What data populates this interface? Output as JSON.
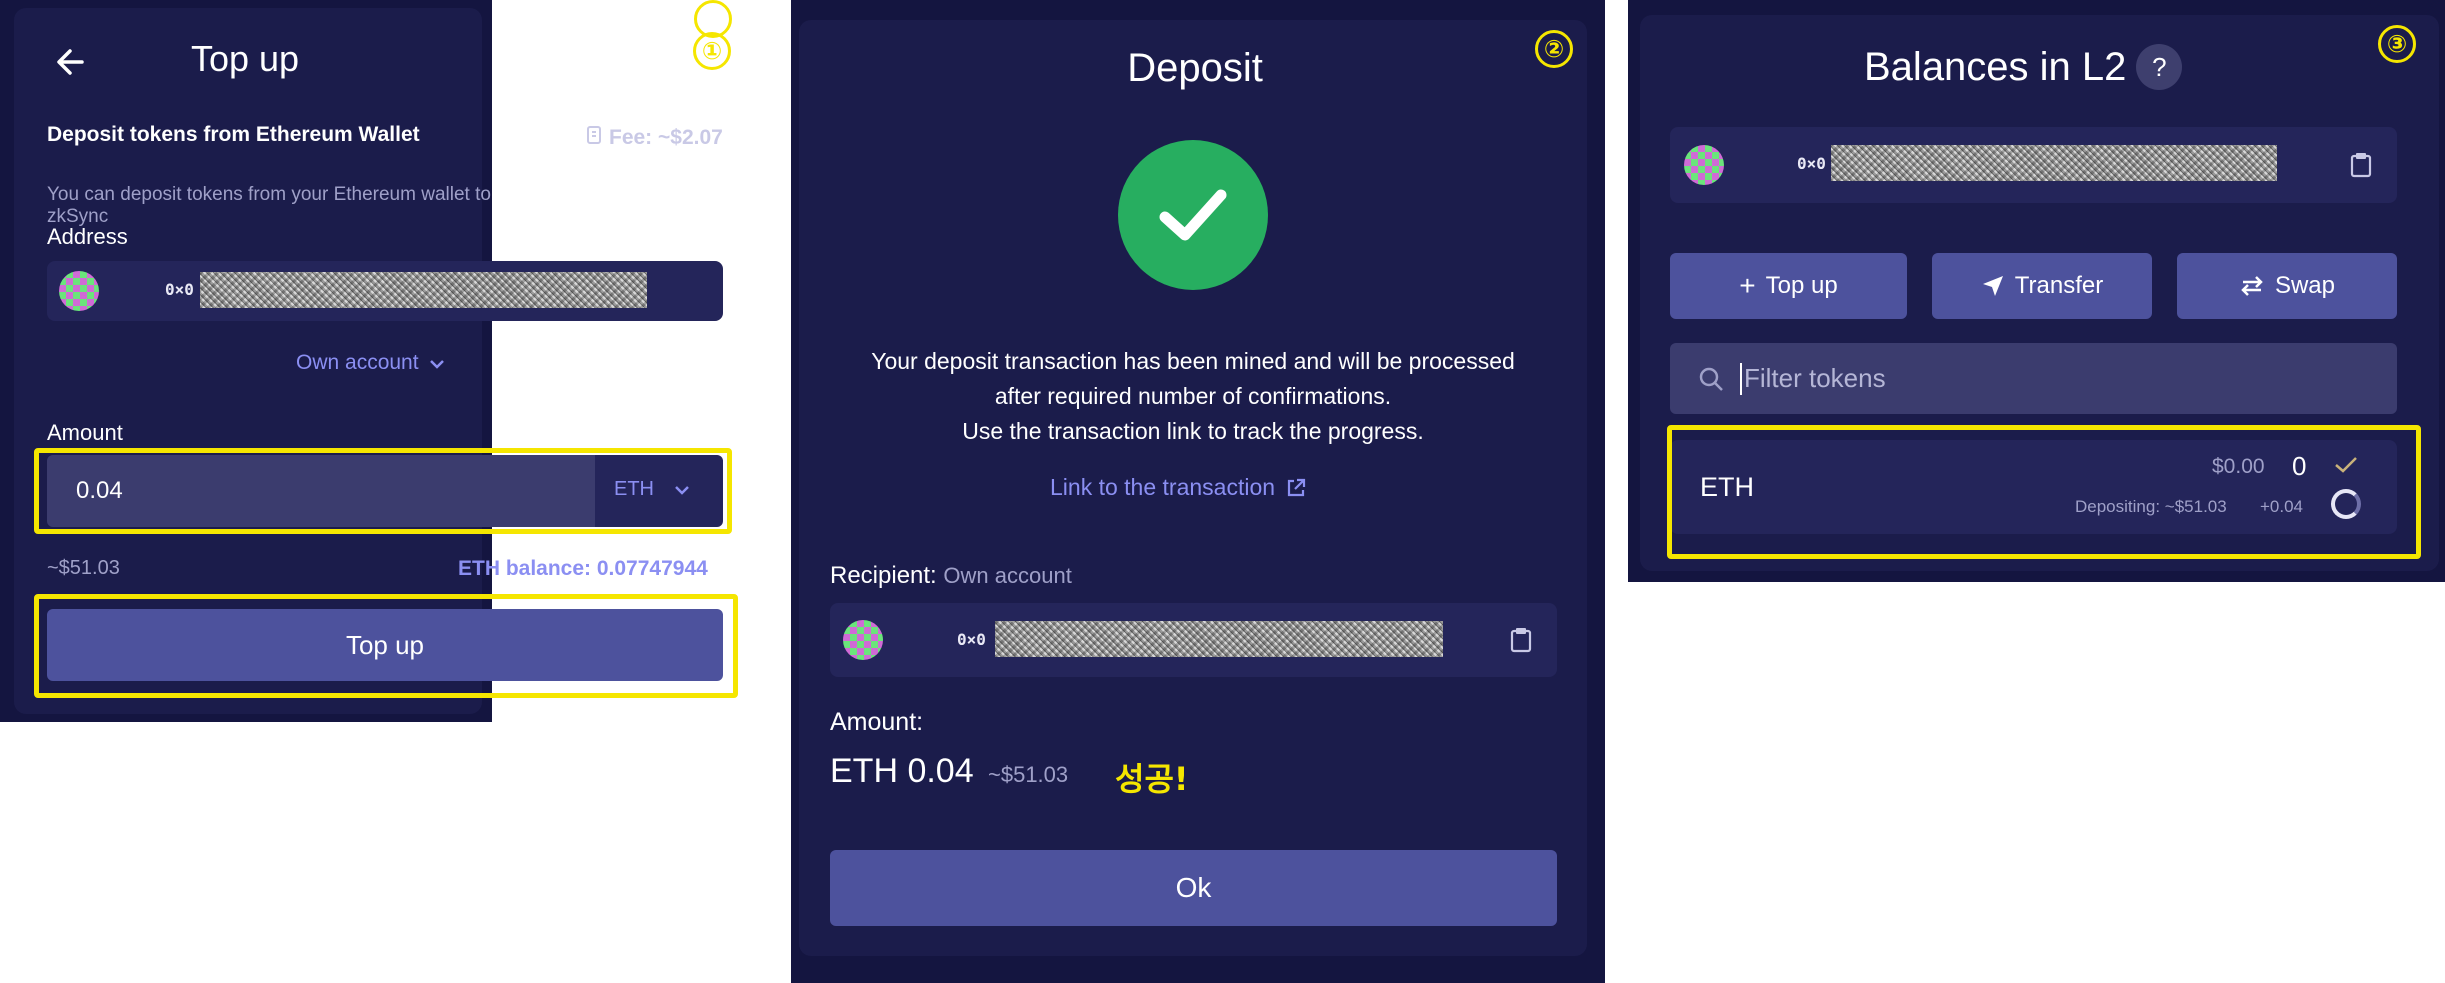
{
  "panel1": {
    "step": "①",
    "title": "Top up",
    "subtitle": "Deposit tokens from Ethereum Wallet",
    "fee": "Fee: ~$2.07",
    "description": "You can deposit tokens from your Ethereum wallet to zkSync",
    "address_label": "Address",
    "address_prefix": "0×0",
    "own_account": "Own account",
    "amount_label": "Amount",
    "amount_value": "0.04",
    "token": "ETH",
    "usd_value": "~$51.03",
    "balance": "ETH balance: 0.07747944",
    "topup_button": "Top up"
  },
  "panel2": {
    "step": "②",
    "title": "Deposit",
    "message_line1": "Your deposit transaction has been mined and will be processed",
    "message_line2": "after required number of confirmations.",
    "message_line3": "Use the transaction link to track the progress.",
    "tx_link": "Link to the transaction",
    "recipient_label": "Recipient:",
    "recipient_value": "Own account",
    "address_prefix": "0×0",
    "amount_label": "Amount:",
    "amount_value": "ETH 0.04",
    "amount_usd": "~$51.03",
    "success_note": "성공!",
    "ok_button": "Ok"
  },
  "panel3": {
    "step": "③",
    "title": "Balances in L2",
    "help": "?",
    "address_prefix": "0×0",
    "topup_button": "Top up",
    "transfer_button": "Transfer",
    "swap_button": "Swap",
    "filter_placeholder": "Filter tokens",
    "token_name": "ETH",
    "token_usd": "$0.00",
    "token_amount": "0",
    "depositing_text": "Depositing: ~$51.03",
    "depositing_amount": "+0.04"
  },
  "colors": {
    "panel_bg": "#141540",
    "card_bg": "#1b1c4b",
    "button": "#4d529d",
    "highlight": "#f5e600",
    "link": "#8b8ff2",
    "success": "#27ae60"
  }
}
